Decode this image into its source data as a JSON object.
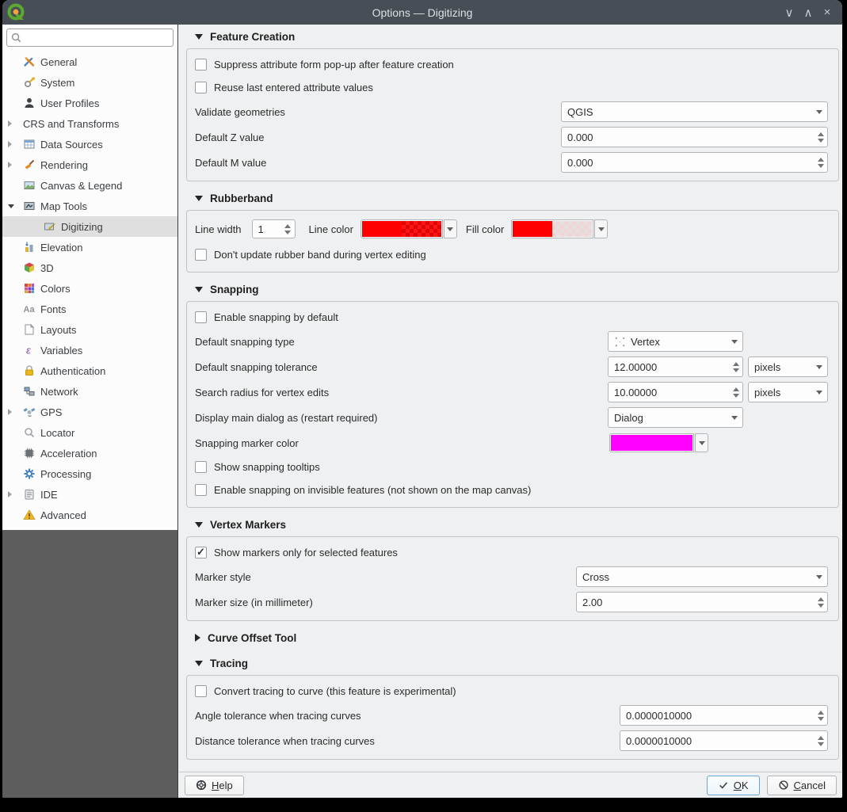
{
  "window": {
    "title": "Options — Digitizing",
    "controls": {
      "shade": "∨",
      "unshade": "∧",
      "close": "×"
    }
  },
  "sidebar": {
    "search": {
      "value": "",
      "placeholder": ""
    },
    "items": [
      {
        "id": "general",
        "label": "General",
        "icon": "general",
        "arrow": "none",
        "indent": 0,
        "selected": false
      },
      {
        "id": "system",
        "label": "System",
        "icon": "system",
        "arrow": "none",
        "indent": 0,
        "selected": false
      },
      {
        "id": "user-profiles",
        "label": "User Profiles",
        "icon": "user",
        "arrow": "none",
        "indent": 0,
        "selected": false
      },
      {
        "id": "crs-transforms",
        "label": "CRS and Transforms",
        "icon": null,
        "arrow": "collapsed",
        "indent": 0,
        "selected": false
      },
      {
        "id": "data-sources",
        "label": "Data Sources",
        "icon": "data-sources",
        "arrow": "collapsed",
        "indent": 0,
        "selected": false
      },
      {
        "id": "rendering",
        "label": "Rendering",
        "icon": "rendering",
        "arrow": "collapsed",
        "indent": 0,
        "selected": false
      },
      {
        "id": "canvas-legend",
        "label": "Canvas & Legend",
        "icon": "canvas",
        "arrow": "none",
        "indent": 0,
        "selected": false
      },
      {
        "id": "map-tools",
        "label": "Map Tools",
        "icon": "map-tools",
        "arrow": "expanded",
        "indent": 0,
        "selected": false
      },
      {
        "id": "digitizing",
        "label": "Digitizing",
        "icon": "digitizing",
        "arrow": "none",
        "indent": 1,
        "selected": true
      },
      {
        "id": "elevation",
        "label": "Elevation",
        "icon": "elevation",
        "arrow": "none",
        "indent": 0,
        "selected": false
      },
      {
        "id": "3d",
        "label": "3D",
        "icon": "cube",
        "arrow": "none",
        "indent": 0,
        "selected": false
      },
      {
        "id": "colors",
        "label": "Colors",
        "icon": "colors",
        "arrow": "none",
        "indent": 0,
        "selected": false
      },
      {
        "id": "fonts",
        "label": "Fonts",
        "icon": "fonts",
        "arrow": "none",
        "indent": 0,
        "selected": false
      },
      {
        "id": "layouts",
        "label": "Layouts",
        "icon": "layouts",
        "arrow": "none",
        "indent": 0,
        "selected": false
      },
      {
        "id": "variables",
        "label": "Variables",
        "icon": "variables",
        "arrow": "none",
        "indent": 0,
        "selected": false
      },
      {
        "id": "authentication",
        "label": "Authentication",
        "icon": "lock",
        "arrow": "none",
        "indent": 0,
        "selected": false
      },
      {
        "id": "network",
        "label": "Network",
        "icon": "network",
        "arrow": "none",
        "indent": 0,
        "selected": false
      },
      {
        "id": "gps",
        "label": "GPS",
        "icon": "gps",
        "arrow": "collapsed",
        "indent": 0,
        "selected": false
      },
      {
        "id": "locator",
        "label": "Locator",
        "icon": "locator",
        "arrow": "none",
        "indent": 0,
        "selected": false
      },
      {
        "id": "acceleration",
        "label": "Acceleration",
        "icon": "acceleration",
        "arrow": "none",
        "indent": 0,
        "selected": false
      },
      {
        "id": "processing",
        "label": "Processing",
        "icon": "processing",
        "arrow": "none",
        "indent": 0,
        "selected": false
      },
      {
        "id": "ide",
        "label": "IDE",
        "icon": "ide",
        "arrow": "collapsed",
        "indent": 0,
        "selected": false
      },
      {
        "id": "advanced",
        "label": "Advanced",
        "icon": "warning",
        "arrow": "none",
        "indent": 0,
        "selected": false
      }
    ]
  },
  "feature_creation": {
    "title": "Feature Creation",
    "suppress_label": "Suppress attribute form pop-up after feature creation",
    "suppress_checked": false,
    "reuse_label": "Reuse last entered attribute values",
    "reuse_checked": false,
    "validate_label": "Validate geometries",
    "validate_value": "QGIS",
    "z_label": "Default Z value",
    "z_value": "0.000",
    "m_label": "Default M value",
    "m_value": "0.000"
  },
  "rubberband": {
    "title": "Rubberband",
    "line_width_label": "Line width",
    "line_width_value": "1",
    "line_color_label": "Line color",
    "line_color": "#ff0000",
    "fill_color_label": "Fill color",
    "fill_color": "#ff0000",
    "dont_update_label": "Don't update rubber band during vertex editing",
    "dont_update_checked": false
  },
  "snapping": {
    "title": "Snapping",
    "enable_label": "Enable snapping by default",
    "enable_checked": false,
    "type_label": "Default snapping type",
    "type_value": "Vertex",
    "tolerance_label": "Default snapping tolerance",
    "tolerance_value": "12.00000",
    "tolerance_unit": "pixels",
    "radius_label": "Search radius for vertex edits",
    "radius_value": "10.00000",
    "radius_unit": "pixels",
    "dialog_label": "Display main dialog as (restart required)",
    "dialog_value": "Dialog",
    "marker_color_label": "Snapping marker color",
    "marker_color": "#ff00ff",
    "tooltips_label": "Show snapping tooltips",
    "tooltips_checked": false,
    "invisible_label": "Enable snapping on invisible features (not shown on the map canvas)",
    "invisible_checked": false
  },
  "vertex_markers": {
    "title": "Vertex Markers",
    "show_label": "Show markers only for selected features",
    "show_checked": true,
    "style_label": "Marker style",
    "style_value": "Cross",
    "size_label": "Marker size (in millimeter)",
    "size_value": "2.00"
  },
  "curve_offset": {
    "title": "Curve Offset Tool"
  },
  "tracing": {
    "title": "Tracing",
    "convert_label": "Convert tracing to curve (this feature is experimental)",
    "convert_checked": false,
    "angle_label": "Angle tolerance when tracing curves",
    "angle_value": "0.0000010000",
    "distance_label": "Distance tolerance when tracing curves",
    "distance_value": "0.0000010000"
  },
  "footer": {
    "help": "Help",
    "ok": "OK",
    "cancel": "Cancel"
  },
  "colors": {
    "titlebar": "#474e56",
    "accent": "#3daee9",
    "line_color": "#ff0000",
    "fill_color": "#ff0000",
    "snap_marker": "#ff00ff"
  }
}
